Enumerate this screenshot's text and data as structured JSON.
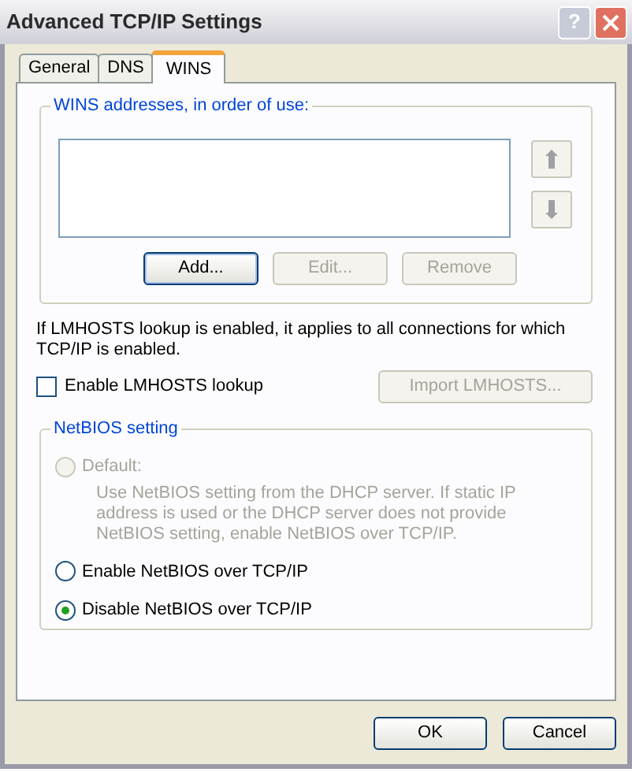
{
  "window": {
    "title": "Advanced TCP/IP Settings",
    "help_button": "?"
  },
  "tabs": [
    {
      "label": "General",
      "selected": false
    },
    {
      "label": "DNS",
      "selected": false
    },
    {
      "label": "WINS",
      "selected": true
    }
  ],
  "wins_group": {
    "label": "WINS addresses, in order of use:",
    "move_up_disabled": true,
    "move_down_disabled": true,
    "buttons": [
      {
        "label": "Add...",
        "disabled": false,
        "default": true
      },
      {
        "label": "Edit...",
        "disabled": true,
        "default": false
      },
      {
        "label": "Remove",
        "disabled": true,
        "default": false
      }
    ]
  },
  "info_text": "If LMHOSTS lookup is enabled, it applies to all connections for which TCP/IP is enabled.",
  "lmhosts_checkbox": {
    "label": "Enable LMHOSTS lookup",
    "checked": false
  },
  "import_button": {
    "label": "Import LMHOSTS...",
    "disabled": true
  },
  "netbios_group": {
    "label": "NetBIOS setting",
    "options": [
      {
        "label": "Default:",
        "selected": false,
        "disabled": true,
        "description": "Use NetBIOS setting from the DHCP server. If static IP address is used or the DHCP server does not provide NetBIOS setting, enable NetBIOS over TCP/IP."
      },
      {
        "label": "Enable NetBIOS over TCP/IP",
        "selected": false,
        "disabled": false
      },
      {
        "label": "Disable NetBIOS over TCP/IP",
        "selected": true,
        "disabled": false
      }
    ]
  },
  "footer_buttons": [
    {
      "label": "OK"
    },
    {
      "label": "Cancel"
    }
  ]
}
